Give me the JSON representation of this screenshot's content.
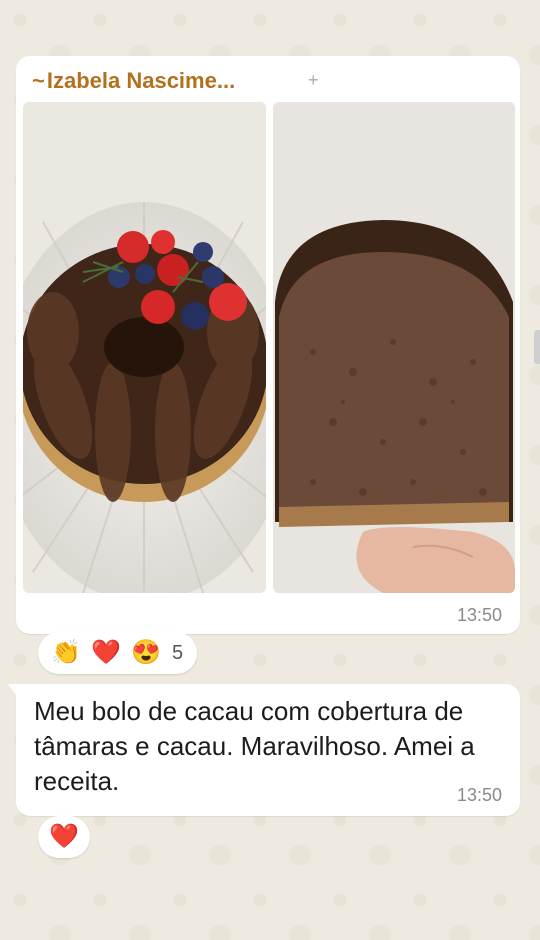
{
  "media_message": {
    "sender": "Izabela Nascime...",
    "sender_prefix": "~",
    "sender_suffix": "+",
    "time": "13:50",
    "colors": {
      "sender": "#b3701d",
      "bubble": "#ffffff",
      "time": "#8a8a8a"
    }
  },
  "media_reactions": {
    "items": [
      "clapping-hands-emoji",
      "red-heart-emoji",
      "heart-eyes-emoji"
    ],
    "glyphs": [
      "👏",
      "❤️",
      "😍"
    ],
    "count": "5"
  },
  "text_message": {
    "text": "Meu bolo de cacau com cobertura de tâmaras e cacau. Maravilhoso. Amei a receita.",
    "time": "13:50"
  },
  "text_reactions": {
    "items": [
      "red-heart-emoji"
    ],
    "glyphs": [
      "❤️"
    ]
  }
}
